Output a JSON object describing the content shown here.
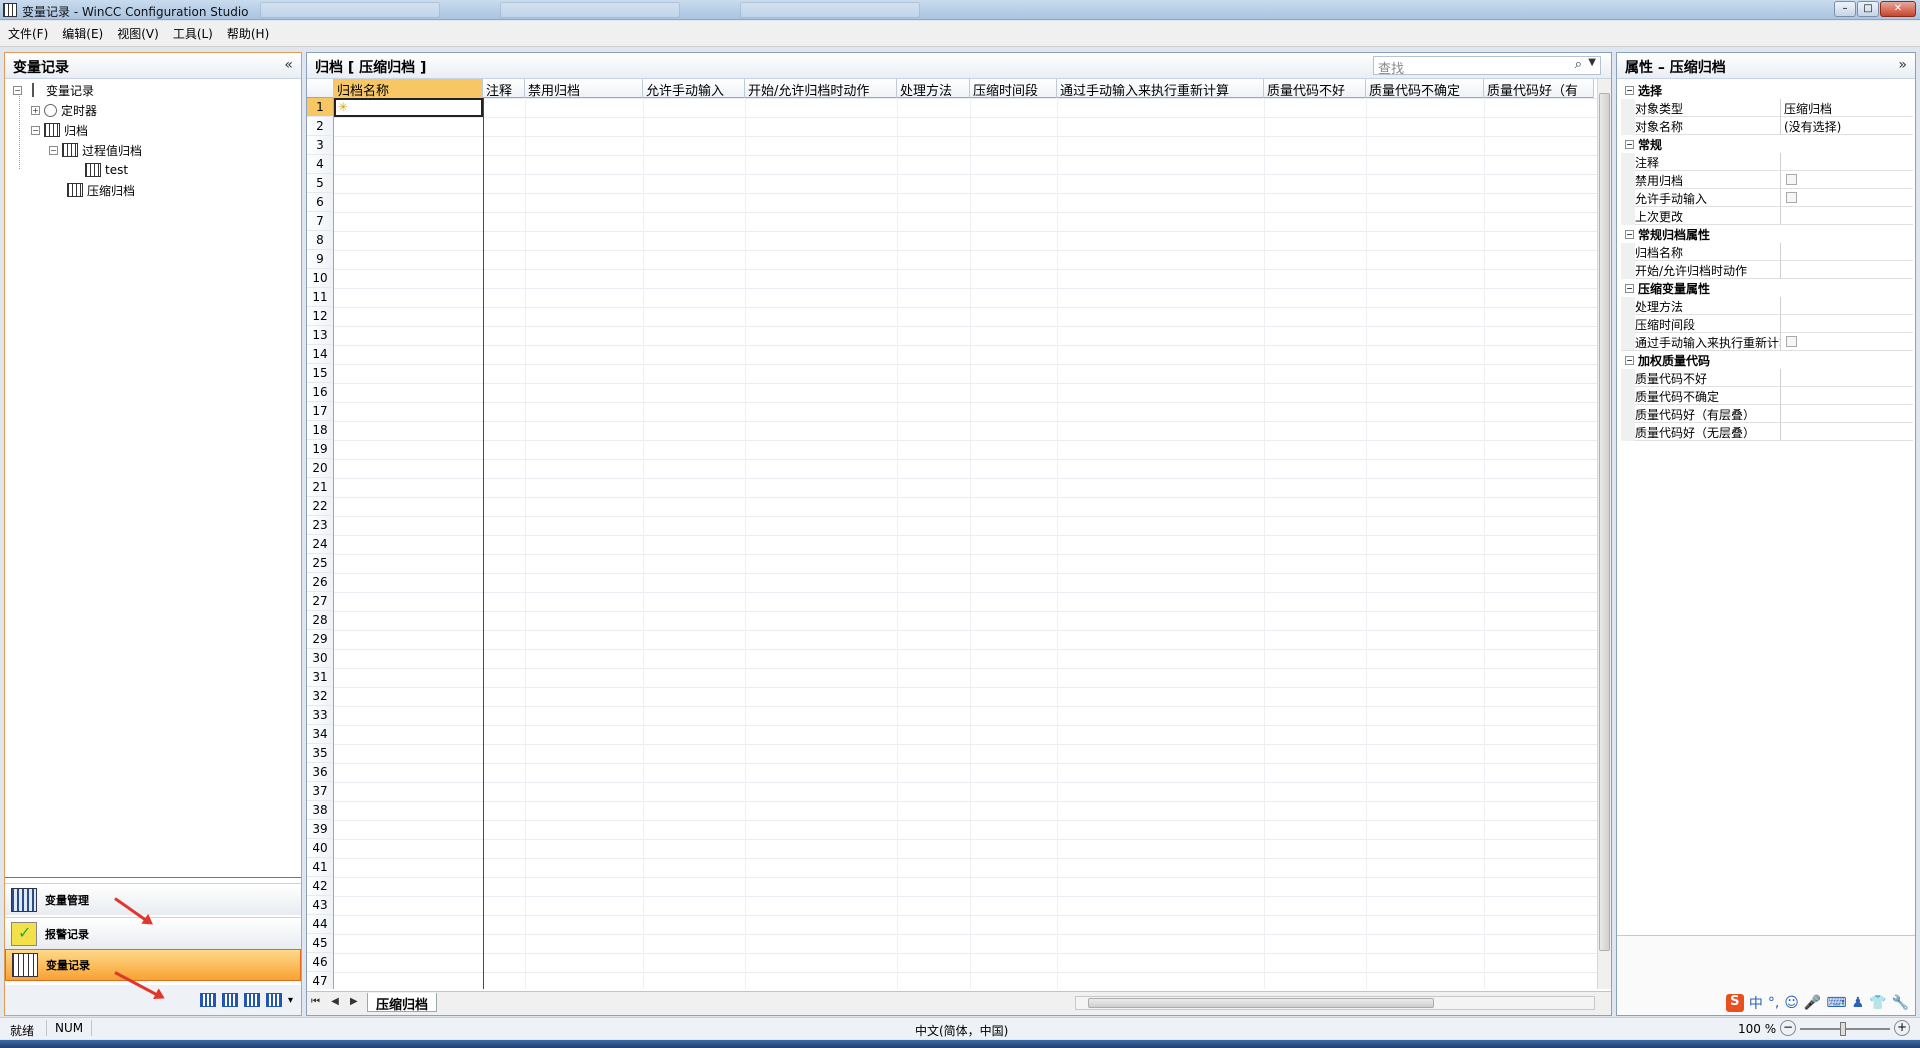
{
  "window": {
    "title": "变量记录 - WinCC Configuration Studio",
    "controls": [
      "–",
      "□",
      "✕"
    ]
  },
  "menu": [
    "文件(F)",
    "编辑(E)",
    "视图(V)",
    "工具(L)",
    "帮助(H)"
  ],
  "left_panel": {
    "title": "变量记录",
    "collapse": "«",
    "tree": {
      "root": "变量记录",
      "timer": "定时器",
      "archive": "归档",
      "process_archive": "过程值归档",
      "test": "test",
      "compressed_archive": "压缩归档"
    },
    "nav": {
      "tag_management": "变量管理",
      "alarm_logging": "报警记录",
      "tag_logging": "变量记录"
    }
  },
  "center": {
    "title": "归档 [ 压缩归档 ]",
    "search_placeholder": "查找",
    "columns": [
      "归档名称",
      "注释",
      "禁用归档",
      "允许手动输入",
      "开始/允许归档时动作",
      "处理方法",
      "压缩时间段",
      "通过手动输入来执行重新计算",
      "质量代码不好",
      "质量代码不确定",
      "质量代码好（有"
    ],
    "row_numbers": [
      "1",
      "2",
      "3",
      "4",
      "5",
      "6",
      "7",
      "8",
      "9",
      "10",
      "11",
      "12",
      "13",
      "14",
      "15",
      "16",
      "17",
      "18",
      "19",
      "20",
      "21",
      "22",
      "23",
      "24",
      "25",
      "26",
      "27",
      "28",
      "29",
      "30",
      "31",
      "32",
      "33",
      "34",
      "35",
      "36",
      "37",
      "38",
      "39",
      "40",
      "41",
      "42",
      "43",
      "44",
      "45",
      "46",
      "47"
    ],
    "sheet_nav": "⏮ ◀ ▶ ⏭",
    "sheet_tab": "压缩归档"
  },
  "right_panel": {
    "title": "属性 – 压缩归档",
    "collapse": "»",
    "categories": {
      "select": "选择",
      "general": "常规",
      "general_archive": "常规归档属性",
      "compress_tag": "压缩变量属性",
      "weighted_quality": "加权质量代码"
    },
    "props": {
      "object_type": "对象类型",
      "object_type_val": "压缩归档",
      "object_name": "对象名称",
      "object_name_val": "(没有选择)",
      "comment": "注释",
      "disable_archive": "禁用归档",
      "allow_manual": "允许手动输入",
      "last_change": "上次更改",
      "archive_name": "归档名称",
      "start_action": "开始/允许归档时动作",
      "method": "处理方法",
      "compress_period": "压缩时间段",
      "recalc": "通过手动输入来执行重新计算",
      "qc_bad": "质量代码不好",
      "qc_uncertain": "质量代码不确定",
      "qc_good_layered": "质量代码好（有层叠）",
      "qc_good_nolayer": "质量代码好（无层叠）"
    },
    "ime": "中"
  },
  "status": {
    "ready": "就绪",
    "num": "NUM",
    "locale": "中文(简体，中国)",
    "zoom": "100 %",
    "zoom_minus": "−",
    "zoom_plus": "+"
  }
}
